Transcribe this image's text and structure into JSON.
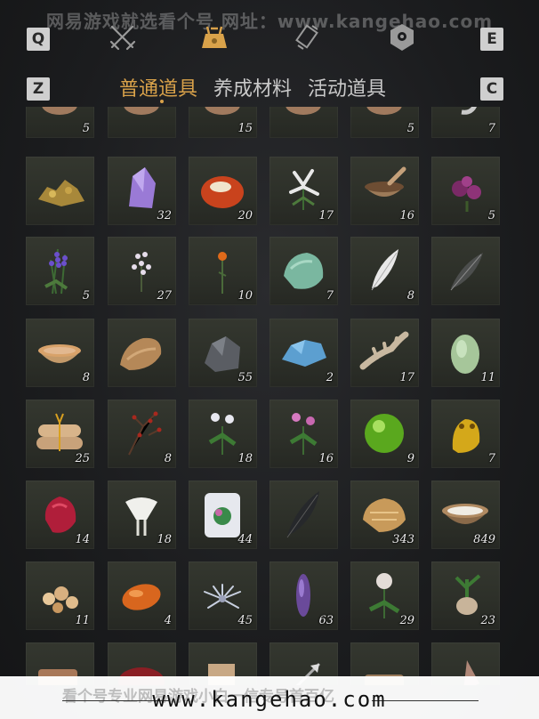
{
  "watermark_top": "网易游戏就选看个号 网址：www.kangehao.com",
  "keys": {
    "q": "Q",
    "e": "E",
    "z": "Z",
    "c": "C"
  },
  "tabs": [
    {
      "label": "普通道具",
      "active": true
    },
    {
      "label": "养成材料",
      "active": false
    },
    {
      "label": "活动道具",
      "active": false
    }
  ],
  "top_icons": [
    "crossed-swords-icon",
    "pouch-icon",
    "scroll-icon",
    "badge-icon"
  ],
  "rows": [
    [
      {
        "icon": "ore-chunk-icon",
        "count": "5"
      },
      {
        "icon": "ore-chunk-icon",
        "count": ""
      },
      {
        "icon": "ore-chunk-icon",
        "count": "15"
      },
      {
        "icon": "ore-chunk-icon",
        "count": ""
      },
      {
        "icon": "ore-chunk-icon",
        "count": "5"
      },
      {
        "icon": "claw-icon",
        "count": "7"
      }
    ],
    [
      {
        "icon": "gold-ore-icon",
        "count": ""
      },
      {
        "icon": "amethyst-icon",
        "count": "32"
      },
      {
        "icon": "red-stone-icon",
        "count": "20"
      },
      {
        "icon": "white-herb-icon",
        "count": "17"
      },
      {
        "icon": "mortar-icon",
        "count": "16"
      },
      {
        "icon": "purple-flower-icon",
        "count": "5"
      }
    ],
    [
      {
        "icon": "lavender-icon",
        "count": "5"
      },
      {
        "icon": "white-blossom-icon",
        "count": "27"
      },
      {
        "icon": "orange-flower-icon",
        "count": "10"
      },
      {
        "icon": "jade-stone-icon",
        "count": "7"
      },
      {
        "icon": "white-feather-icon",
        "count": "8"
      },
      {
        "icon": "dark-feather-icon",
        "count": ""
      }
    ],
    [
      {
        "icon": "soup-bowl-icon",
        "count": "8"
      },
      {
        "icon": "fur-pelt-icon",
        "count": ""
      },
      {
        "icon": "iron-ore-icon",
        "count": "55"
      },
      {
        "icon": "blue-crystal-icon",
        "count": "2"
      },
      {
        "icon": "bone-icon",
        "count": "17"
      },
      {
        "icon": "melon-icon",
        "count": "11"
      }
    ],
    [
      {
        "icon": "rice-bundle-icon",
        "count": "25"
      },
      {
        "icon": "red-berry-twig-icon",
        "count": "8"
      },
      {
        "icon": "white-chrysanthemum-icon",
        "count": "18"
      },
      {
        "icon": "pink-flower-icon",
        "count": "16"
      },
      {
        "icon": "green-orb-icon",
        "count": "9"
      },
      {
        "icon": "golden-toad-icon",
        "count": "7"
      }
    ],
    [
      {
        "icon": "ruby-icon",
        "count": "14"
      },
      {
        "icon": "white-lily-icon",
        "count": "18"
      },
      {
        "icon": "jade-carving-icon",
        "count": "44"
      },
      {
        "icon": "black-feather-icon",
        "count": ""
      },
      {
        "icon": "gold-nugget-icon",
        "count": "343"
      },
      {
        "icon": "milk-bowl-icon",
        "count": "849"
      }
    ],
    [
      {
        "icon": "amber-chunks-icon",
        "count": "11"
      },
      {
        "icon": "orange-gem-icon",
        "count": "4"
      },
      {
        "icon": "spider-lily-icon",
        "count": "45"
      },
      {
        "icon": "purple-spike-icon",
        "count": "63"
      },
      {
        "icon": "white-rose-icon",
        "count": "29"
      },
      {
        "icon": "root-plant-icon",
        "count": "23"
      }
    ],
    [
      {
        "icon": "comb-icon",
        "count": ""
      },
      {
        "icon": "red-cloth-icon",
        "count": ""
      },
      {
        "icon": "paper-scroll-icon",
        "count": ""
      },
      {
        "icon": "arrow-icon",
        "count": ""
      },
      {
        "icon": "wood-item-icon",
        "count": ""
      },
      {
        "icon": "misc-item-icon",
        "count": ""
      }
    ]
  ],
  "banner": {
    "url": "www.kangehao.com",
    "sub": "看个号专业网易游戏小白一信专号首百亿"
  },
  "colors": {
    "accent": "#d9a24a",
    "cell": "#2d3029",
    "text": "#ececec"
  }
}
